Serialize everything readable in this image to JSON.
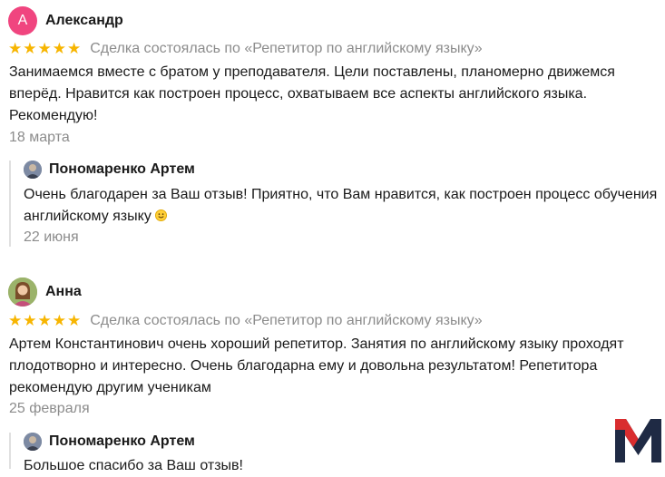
{
  "reviews": [
    {
      "avatar_letter": "А",
      "author": "Александр",
      "rating": 5,
      "deal": "Сделка состоялась по «Репетитор по английскому языку»",
      "text": "Занимаемся вместе с братом у преподавателя. Цели поставлены, планомерно движемся вперёд. Нравится как построен процесс, охватываем все аспекты английского языка. Рекомендую!",
      "date": "18 марта",
      "reply": {
        "author": "Пономаренко Артем",
        "text": "Очень благодарен за Ваш отзыв! Приятно, что Вам нравится, как построен процесс обучения английскому языку",
        "date": "22 июня"
      }
    },
    {
      "author": "Анна",
      "rating": 5,
      "deal": "Сделка состоялась по «Репетитор по английскому языку»",
      "text": "Артем Константинович очень хороший репетитор. Занятия по английскому языку проходят плодотворно и интересно. Очень благодарна ему и довольна результатом! Репетитора рекомендую другим ученикам",
      "date": "25 февраля",
      "reply": {
        "author": "Пономаренко Артем",
        "text": "Большое спасибо за Ваш отзыв!"
      }
    }
  ],
  "colors": {
    "star": "#f7b500",
    "avatar_letter_bg": "#f0457f",
    "muted_text": "#8c8c8c",
    "logo_red": "#d92d2f",
    "logo_dark": "#1f2a44"
  },
  "icons": {
    "star": "star-icon",
    "smiley": "smiley-icon",
    "logo": "m-logo-icon"
  }
}
